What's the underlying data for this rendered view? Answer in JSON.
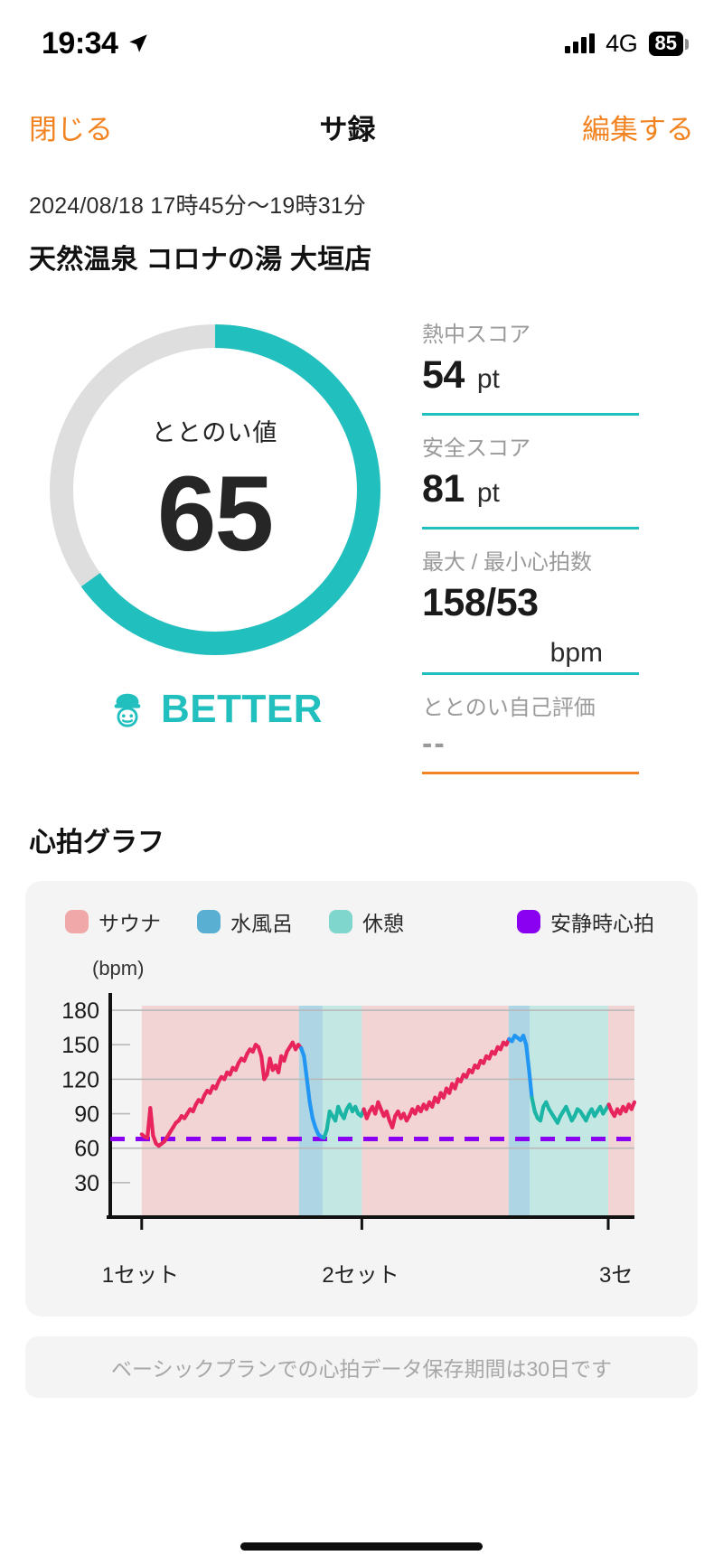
{
  "status_bar": {
    "time": "19:34",
    "location_icon": "location-arrow-icon",
    "signal_icon": "signal-bars-icon",
    "network": "4G",
    "battery": "85"
  },
  "nav": {
    "close_label": "閉じる",
    "title": "サ録",
    "edit_label": "編集する",
    "accent_color": "#F28321"
  },
  "header": {
    "date_range": "2024/08/18 17時45分〜19時31分",
    "venue": "天然温泉 コロナの湯 大垣店"
  },
  "gauge": {
    "label": "ととのい値",
    "value": "65",
    "percent": 65,
    "rank": "BETTER",
    "rank_icon": "sauna-hat-face-icon",
    "arc_color": "#22BFBF",
    "track_color": "#DEDEDE"
  },
  "stats": [
    {
      "label": "熱中スコア",
      "value": "54",
      "unit": "pt",
      "rule_color": "#22BFBF"
    },
    {
      "label": "安全スコア",
      "value": "81",
      "unit": "pt",
      "rule_color": "#22BFBF"
    },
    {
      "label": "最大 / 最小心拍数",
      "value": "158/53",
      "unit": "bpm",
      "rule_color": "#22BFBF"
    },
    {
      "label": "ととのい自己評価",
      "value": "--",
      "unit": "",
      "rule_color": "#F28321"
    }
  ],
  "chart_section": {
    "title": "心拍グラフ",
    "note": "ベーシックプランでの心拍データ保存期間は30日です"
  },
  "chart_data": {
    "type": "line",
    "title": "心拍グラフ",
    "xlabel": "",
    "ylabel": "(bpm)",
    "ylim": [
      0,
      195
    ],
    "yticks": [
      180,
      150,
      120,
      90,
      60,
      30
    ],
    "grid": true,
    "legend_position": "top",
    "legend": [
      {
        "name": "サウナ",
        "color": "#F0A8A8"
      },
      {
        "name": "水風呂",
        "color": "#58AFD1"
      },
      {
        "name": "休憩",
        "color": "#7FD6CC"
      },
      {
        "name": "安静時心拍",
        "color": "#8A00F0"
      }
    ],
    "resting_hr": 68,
    "resting_hr_color": "#8A00F0",
    "xticks": [
      "1セット",
      "2セット",
      "3セ"
    ],
    "series": [
      {
        "name": "心拍数",
        "colors": {
          "sauna": "#E8245C",
          "cold": "#2196F3",
          "rest": "#1BB5A5"
        },
        "values": [
          72,
          70,
          69,
          95,
          71,
          64,
          62,
          64,
          66,
          70,
          74,
          78,
          82,
          84,
          88,
          86,
          90,
          94,
          92,
          98,
          102,
          100,
          106,
          110,
          108,
          114,
          112,
          118,
          122,
          120,
          126,
          124,
          130,
          128,
          134,
          138,
          136,
          142,
          146,
          144,
          150,
          148,
          140,
          120,
          124,
          138,
          128,
          132,
          126,
          140,
          136,
          144,
          148,
          152,
          146,
          150,
          147,
          140,
          120,
          100,
          86,
          78,
          72,
          70,
          69,
          76,
          92,
          88,
          84,
          96,
          90,
          86,
          94,
          98,
          92,
          96,
          90,
          88,
          94,
          86,
          92,
          96,
          90,
          100,
          94,
          88,
          92,
          84,
          78,
          88,
          92,
          86,
          90,
          84,
          88,
          94,
          90,
          96,
          92,
          98,
          94,
          100,
          96,
          104,
          100,
          108,
          104,
          112,
          108,
          116,
          112,
          120,
          118,
          124,
          122,
          128,
          126,
          132,
          130,
          136,
          134,
          140,
          138,
          144,
          142,
          148,
          146,
          152,
          150,
          155,
          153,
          158,
          156,
          154,
          158,
          150,
          128,
          104,
          92,
          86,
          84,
          96,
          100,
          94,
          90,
          86,
          82,
          88,
          92,
          96,
          90,
          84,
          88,
          94,
          92,
          88,
          84,
          90,
          94,
          88,
          92,
          96,
          90,
          94,
          98,
          92,
          88,
          94,
          90,
          96,
          92,
          98,
          94,
          100
        ]
      }
    ],
    "phase_bands": [
      {
        "phase": "サウナ",
        "start_pct": 6.0,
        "end_pct": 36.0,
        "color": "#F0A8A8"
      },
      {
        "phase": "水風呂",
        "start_pct": 36.0,
        "end_pct": 40.5,
        "color": "#58AFD1"
      },
      {
        "phase": "休憩",
        "start_pct": 40.5,
        "end_pct": 48.0,
        "color": "#7FD6CC"
      },
      {
        "phase": "サウナ",
        "start_pct": 48.0,
        "end_pct": 76.0,
        "color": "#F0A8A8"
      },
      {
        "phase": "水風呂",
        "start_pct": 76.0,
        "end_pct": 80.0,
        "color": "#58AFD1"
      },
      {
        "phase": "休憩",
        "start_pct": 80.0,
        "end_pct": 95.0,
        "color": "#7FD6CC"
      },
      {
        "phase": "サウナ",
        "start_pct": 95.0,
        "end_pct": 100.0,
        "color": "#F0A8A8"
      }
    ]
  }
}
